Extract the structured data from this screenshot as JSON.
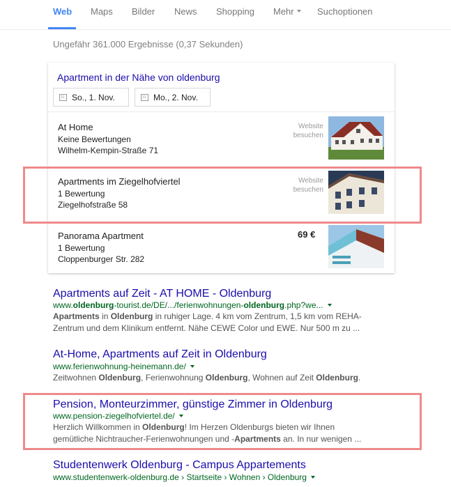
{
  "nav": {
    "tabs": [
      "Web",
      "Maps",
      "Bilder",
      "News",
      "Shopping",
      "Mehr",
      "Suchoptionen"
    ]
  },
  "stats": "Ungefähr 361.000 Ergebnisse (0,37 Sekunden)",
  "local": {
    "title": "Apartment in der Nähe von oldenburg",
    "checkin": "So., 1. Nov.",
    "checkout": "Mo., 2. Nov.",
    "website_line1": "Website",
    "website_line2": "besuchen",
    "listings": [
      {
        "name": "At Home",
        "reviews": "Keine Bewertungen",
        "address": "Wilhelm-Kempin-Straße 71"
      },
      {
        "name": "Apartments im Ziegelhofviertel",
        "reviews": "1 Bewertung",
        "address": "Ziegelhofstraße 58"
      },
      {
        "name": "Panorama Apartment",
        "reviews": "1 Bewertung",
        "address": "Cloppenburger Str. 282",
        "price": "69 €"
      }
    ]
  },
  "results": [
    {
      "title": "Apartments auf Zeit - AT HOME - Oldenburg",
      "url_parts": [
        "www.",
        "oldenburg",
        "-tourist.de/DE/.../ferienwohnungen-",
        "oldenburg",
        ".php?we..."
      ],
      "snippet_line1": [
        "Apartments",
        " in ",
        "Oldenburg",
        " in ruhiger Lage. 4 km vom Zentrum, 1,5 km vom REHA-"
      ],
      "snippet_line2": "Zentrum und dem Klinikum entfernt. Nähe CEWE Color und EWE. Nur 500 m zu ..."
    },
    {
      "title": "At-Home, Apartments auf Zeit in Oldenburg",
      "url": "www.ferienwohnung-heinemann.de/",
      "snippet_line1": [
        "Zeitwohnen ",
        "Oldenburg",
        ", Ferienwohnung ",
        "Oldenburg",
        ", Wohnen auf Zeit ",
        "Oldenburg",
        "."
      ]
    },
    {
      "title": "Pension, Monteurzimmer, günstige Zimmer in Oldenburg",
      "url": "www.pension-ziegelhofviertel.de/",
      "snippet_line1": [
        "Herzlich Willkommen in ",
        "Oldenburg",
        "! Im Herzen Oldenburgs bieten wir Ihnen"
      ],
      "snippet_line2": [
        "gemütliche Nichtraucher-Ferienwohnungen und -",
        "Apartments",
        " an. In nur wenigen ..."
      ]
    },
    {
      "title": "Studentenwerk Oldenburg - Campus Appartements",
      "url": "www.studentenwerk-oldenburg.de › Startseite › Wohnen › Oldenburg"
    }
  ],
  "colors": {
    "highlight": "#ef8a8a",
    "link": "#1a0dab",
    "url": "#006621",
    "accent": "#4285f4"
  }
}
